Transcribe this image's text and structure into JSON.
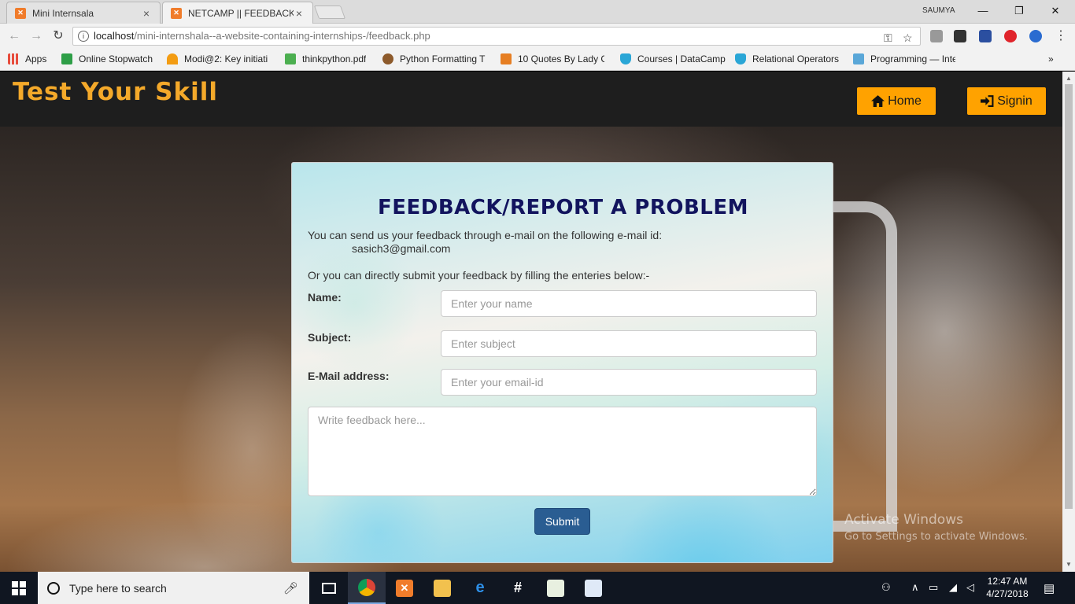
{
  "browser": {
    "tabs": [
      {
        "title": "Mini Internsala",
        "active": false
      },
      {
        "title": "NETCAMP || FEEDBACK",
        "active": true
      }
    ],
    "user": "SAUMYA",
    "url_host": "localhost",
    "url_path": "/mini-internshala--a-website-containing-internships-/feedback.php",
    "bookmarks": [
      {
        "label": "Apps",
        "color": "#e74c3c"
      },
      {
        "label": "Online Stopwatch",
        "color": "#2e9e47"
      },
      {
        "label": "Modi@2: Key initiati",
        "color": "#f39c12"
      },
      {
        "label": "thinkpython.pdf",
        "color": "#4caf50"
      },
      {
        "label": "Python Formatting T",
        "color": "#8d5a2b"
      },
      {
        "label": "10 Quotes By Lady G",
        "color": "#e67e22"
      },
      {
        "label": "Courses | DataCamp",
        "color": "#2aa6d6"
      },
      {
        "label": "Relational Operators",
        "color": "#2aa6d6"
      },
      {
        "label": "Programming — Inte",
        "color": "#5aa7d8"
      }
    ],
    "more": "»"
  },
  "navbar": {
    "brand": "Test Your Skill",
    "home": "Home",
    "signin": "Signin"
  },
  "feedback": {
    "title": "FEEDBACK/REPORT A PROBLEM",
    "intro": "You can send us your feedback through e-mail on the following e-mail id:",
    "email": "sasich3@gmail.com",
    "or_text": "Or you can directly submit your feedback by filling the enteries below:-",
    "name_label": "Name:",
    "name_placeholder": "Enter your name",
    "subject_label": "Subject:",
    "subject_placeholder": "Enter subject",
    "email_label": "E-Mail address:",
    "email_placeholder": "Enter your email-id",
    "feedback_placeholder": "Write feedback here...",
    "submit": "Submit"
  },
  "watermark": {
    "line1": "Activate Windows",
    "line2": "Go to Settings to activate Windows."
  },
  "taskbar": {
    "search_placeholder": "Type here to search",
    "time": "12:47 AM",
    "date": "4/27/2018"
  }
}
